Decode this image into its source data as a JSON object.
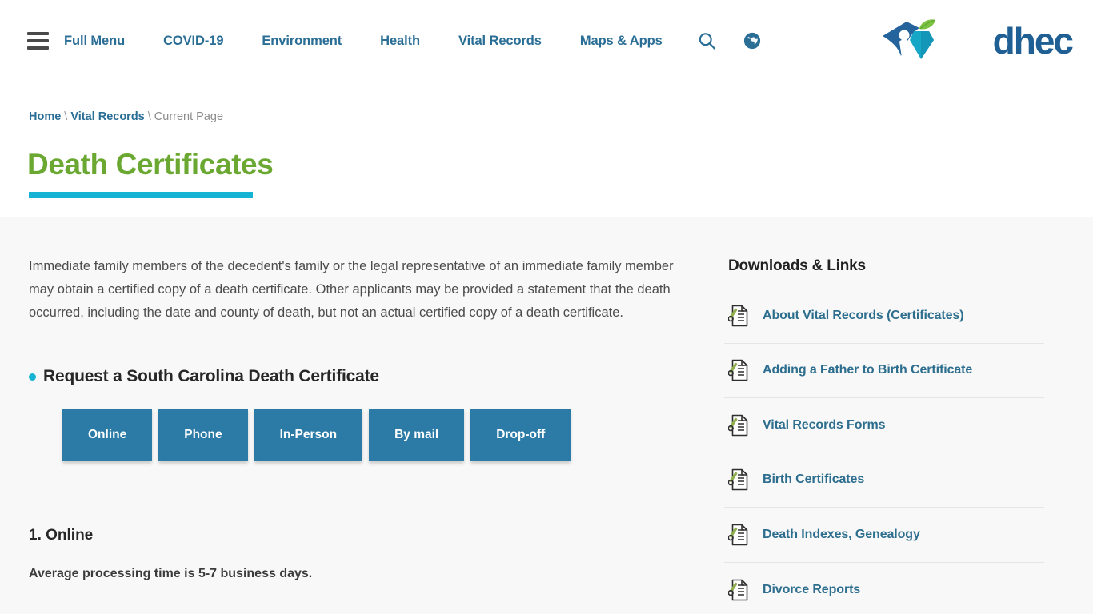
{
  "header": {
    "menu_icon": "hamburger-icon",
    "nav_items": [
      {
        "label": "Full Menu"
      },
      {
        "label": "COVID-19"
      },
      {
        "label": "Environment"
      },
      {
        "label": "Health"
      },
      {
        "label": "Vital Records"
      },
      {
        "label": "Maps & Apps"
      }
    ],
    "search_icon": "search-icon",
    "language_icon": "globe-icon",
    "logo_text": "dhec"
  },
  "breadcrumb": {
    "home": "Home",
    "parent": "Vital Records",
    "current": "Current Page",
    "separator": "\\"
  },
  "page": {
    "title": "Death Certificates",
    "intro": "Immediate family members of the decedent's family or the legal representative of an immediate family member may obtain a certified copy of a death certificate. Other applicants may be provided a statement that the death occurred, including the date and county of death, but not an actual certified copy of a death certificate.",
    "section_heading": "Request a South Carolina Death Certificate",
    "method_buttons": [
      {
        "label": "Online"
      },
      {
        "label": "Phone"
      },
      {
        "label": "In-Person"
      },
      {
        "label": "By mail"
      },
      {
        "label": "Drop-off"
      }
    ],
    "step_heading": "1. Online",
    "step_note": "Average processing time is 5-7 business days."
  },
  "sidebar": {
    "title": "Downloads & Links",
    "items": [
      {
        "label": "About Vital Records (Certificates)",
        "icon": "document-link-icon"
      },
      {
        "label": "Adding a Father to Birth Certificate",
        "icon": "document-link-icon"
      },
      {
        "label": "Vital Records Forms",
        "icon": "document-link-icon"
      },
      {
        "label": "Birth Certificates",
        "icon": "document-link-icon"
      },
      {
        "label": "Death Indexes, Genealogy",
        "icon": "document-link-icon"
      },
      {
        "label": "Divorce Reports",
        "icon": "document-link-icon"
      }
    ]
  },
  "colors": {
    "nav_link": "#2a6e96",
    "title_green": "#6aa832",
    "accent_cyan": "#17b3d4",
    "button_blue": "#2b7ba6",
    "sidebar_link": "#2d6e8e",
    "content_bg": "#f8f8f8"
  }
}
